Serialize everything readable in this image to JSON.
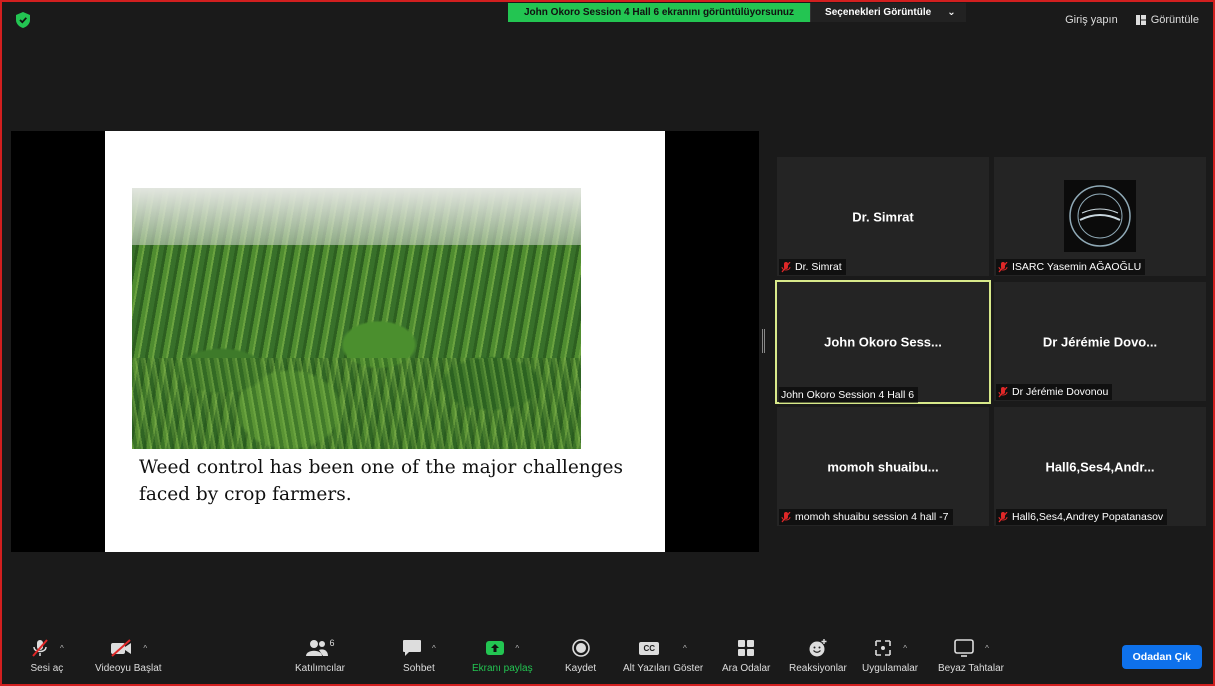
{
  "share_banner": {
    "text": "John Okoro Session 4 Hall 6 ekranını görüntülüyorsunuz",
    "options_label": "Seçenekleri Görüntüle",
    "options_caret": "⌄"
  },
  "top_right": {
    "signin_label": "Giriş yapın",
    "view_label": "Görüntüle"
  },
  "slide": {
    "caption": "Weed control has been one of the major challenges faced by crop farmers."
  },
  "participants": [
    {
      "display": "Dr. Simrat",
      "label": "Dr. Simrat",
      "muted": true,
      "has_logo": false
    },
    {
      "display": "",
      "label": "ISARC Yasemin AĞAOĞLU",
      "muted": true,
      "has_logo": true
    },
    {
      "display": "John Okoro Sess...",
      "label": "John Okoro Session 4 Hall 6",
      "muted": false,
      "active": true
    },
    {
      "display": "Dr Jérémie Dovo...",
      "label": "Dr Jérémie Dovonou",
      "muted": true
    },
    {
      "display": "momoh shuaibu...",
      "label": "momoh shuaibu session 4 hall -7",
      "muted": true
    },
    {
      "display": "Hall6,Ses4,Andr...",
      "label": "Hall6,Ses4,Andrey Popatanasov",
      "muted": true
    }
  ],
  "toolbar": {
    "unmute": "Sesi aç",
    "start_video": "Videoyu Başlat",
    "participants": "Katılımcılar",
    "participants_count": "6",
    "chat": "Sohbet",
    "share_screen": "Ekranı paylaş",
    "record": "Kaydet",
    "captions": "Alt Yazıları Göster",
    "captions_icon_text": "CC",
    "breakout": "Ara Odalar",
    "reactions": "Reaksiyonlar",
    "apps": "Uygulamalar",
    "whiteboards": "Beyaz Tahtalar",
    "caret": "^",
    "leave": "Odadan Çık"
  },
  "colors": {
    "accent_green": "#23c552",
    "leave_blue": "#0e71eb",
    "active_border": "#d8e98a",
    "muted_red": "#e02828"
  }
}
